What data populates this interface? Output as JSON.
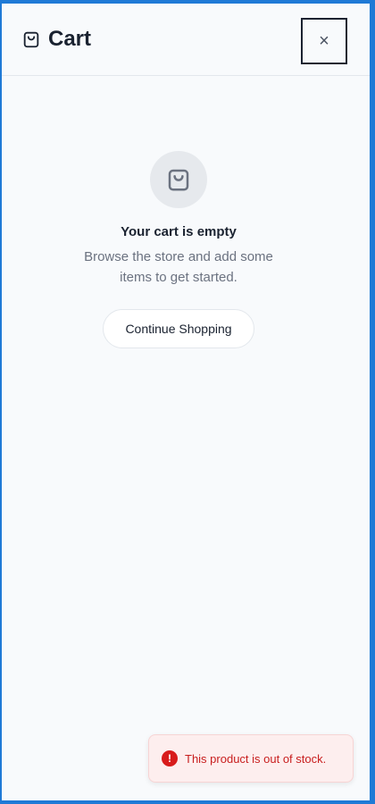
{
  "header": {
    "title": "Cart",
    "close_label": "×"
  },
  "empty_state": {
    "icon": "shopping-bag-icon",
    "title": "Your cart is empty",
    "description": "Browse the store and add some items to get started.",
    "button_label": "Continue Shopping"
  },
  "toast": {
    "icon_glyph": "!",
    "message": "This product is out of stock."
  },
  "colors": {
    "accent_border": "#1f7ad6",
    "panel_bg": "#f8fafc",
    "toast_bg": "#fdeeee",
    "toast_text": "#c81e1e",
    "error_icon": "#d81b1b"
  }
}
